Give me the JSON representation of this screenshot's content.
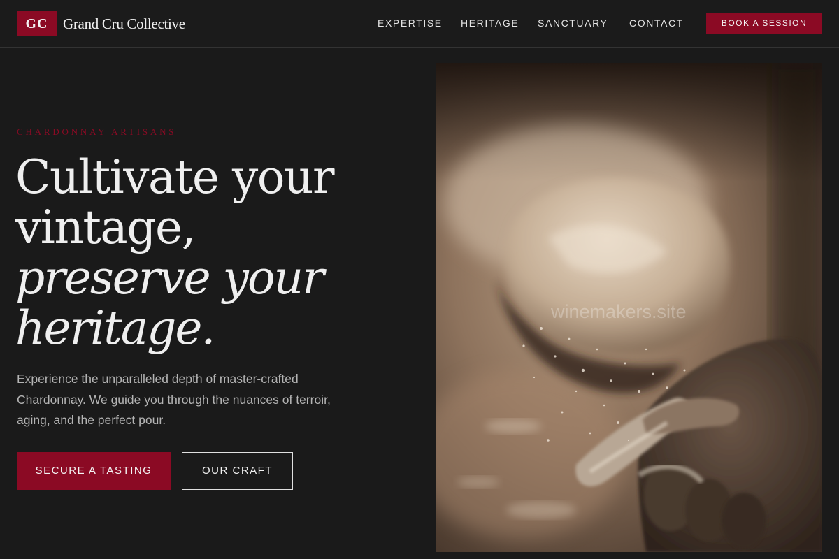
{
  "header": {
    "logo_mark": "GC",
    "brand_name": "Grand Cru Collective",
    "nav": [
      {
        "label": "EXPERTISE"
      },
      {
        "label": "HERITAGE"
      },
      {
        "label": "SANCTUARY"
      },
      {
        "label": "CONTACT"
      }
    ],
    "cta_label": "BOOK A SESSION"
  },
  "hero": {
    "eyebrow": "CHARDONNAY ARTISANS",
    "headline": {
      "line1": "Cultivate your",
      "line2": "vintage,",
      "line3": "preserve your",
      "line4": "heritage."
    },
    "lede": "Experience the unparalleled depth of master-crafted Chardonnay. We guide you through the nuances of terroir, aging, and the perfect pour.",
    "primary_button": "SECURE A TASTING",
    "secondary_button": "OUR CRAFT"
  },
  "image": {
    "watermark": "winemakers.site"
  },
  "colors": {
    "background": "#1a1a1a",
    "accent": "#8b0a24",
    "text": "#efefef",
    "muted_text": "#b4b4b4"
  }
}
